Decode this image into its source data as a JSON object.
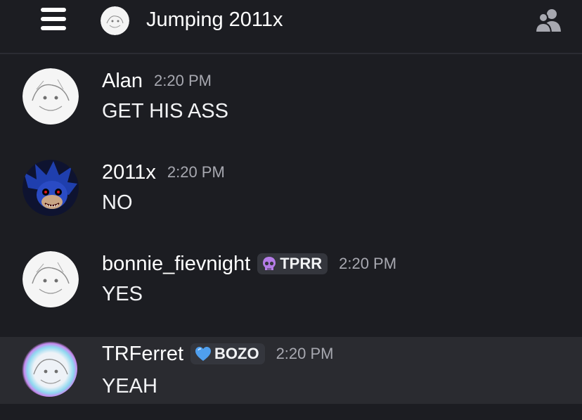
{
  "header": {
    "title": "Jumping 2011x",
    "menu_icon": "hamburger-menu-icon",
    "members_icon": "members-icon"
  },
  "messages": [
    {
      "username": "Alan",
      "tag": "",
      "timestamp": "2:20 PM",
      "text": "GET HIS ASS",
      "highlighted": false
    },
    {
      "username": "2011x",
      "tag": "",
      "timestamp": "2:20 PM",
      "text": "NO",
      "highlighted": false
    },
    {
      "username": "bonnie_fievnight",
      "tag": "TPRR",
      "tag_icon": "skull-icon",
      "timestamp": "2:20 PM",
      "text": "YES",
      "highlighted": false
    },
    {
      "username": "TRFerret",
      "tag": "BOZO",
      "tag_icon": "heart-icon",
      "timestamp": "2:20 PM",
      "text": "YEAH",
      "highlighted": true
    }
  ],
  "colors": {
    "background": "#1c1d22",
    "highlight_row": "#2a2b30",
    "timestamp": "#a7a8b0",
    "tag_background": "#34363d"
  }
}
